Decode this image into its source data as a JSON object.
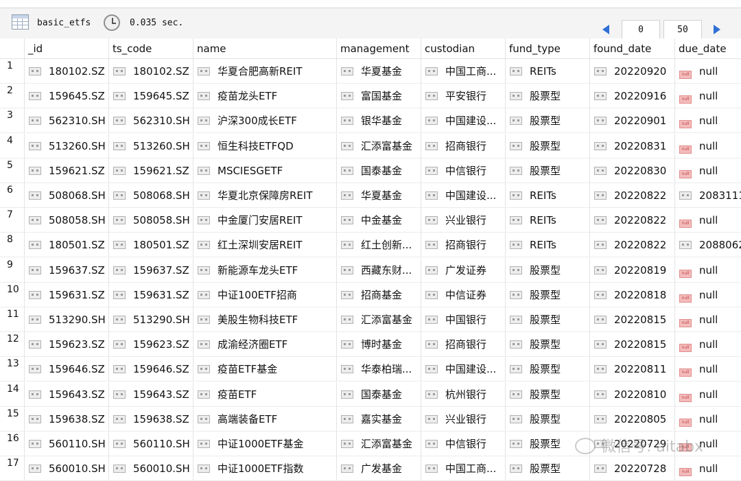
{
  "toolbar": {
    "table_name": "basic_etfs",
    "query_time": "0.035 sec.",
    "pagination": {
      "offset": "0",
      "limit": "50"
    }
  },
  "columns": [
    "_id",
    "ts_code",
    "name",
    "management",
    "custodian",
    "fund_type",
    "found_date",
    "due_date"
  ],
  "rows": [
    {
      "n": "1",
      "id": "180102.SZ",
      "ts": "180102.SZ",
      "name": "华夏合肥高新REIT",
      "mg": "华夏基金",
      "cu": "中国工商...",
      "ft": "REITs",
      "fd": "20220920",
      "dd": "null"
    },
    {
      "n": "2",
      "id": "159645.SZ",
      "ts": "159645.SZ",
      "name": "疫苗龙头ETF",
      "mg": "富国基金",
      "cu": "平安银行",
      "ft": "股票型",
      "fd": "20220916",
      "dd": "null"
    },
    {
      "n": "3",
      "id": "562310.SH",
      "ts": "562310.SH",
      "name": "沪深300成长ETF",
      "mg": "银华基金",
      "cu": "中国建设...",
      "ft": "股票型",
      "fd": "20220901",
      "dd": "null"
    },
    {
      "n": "4",
      "id": "513260.SH",
      "ts": "513260.SH",
      "name": "恒生科技ETFQD",
      "mg": "汇添富基金",
      "cu": "招商银行",
      "ft": "股票型",
      "fd": "20220831",
      "dd": "null"
    },
    {
      "n": "5",
      "id": "159621.SZ",
      "ts": "159621.SZ",
      "name": "MSCIESGETF",
      "mg": "国泰基金",
      "cu": "中信银行",
      "ft": "股票型",
      "fd": "20220830",
      "dd": "null"
    },
    {
      "n": "6",
      "id": "508068.SH",
      "ts": "508068.SH",
      "name": "华夏北京保障房REIT",
      "mg": "华夏基金",
      "cu": "中国建设...",
      "ft": "REITs",
      "fd": "20220822",
      "dd": "2083111"
    },
    {
      "n": "7",
      "id": "508058.SH",
      "ts": "508058.SH",
      "name": "中金厦门安居REIT",
      "mg": "中金基金",
      "cu": "兴业银行",
      "ft": "REITs",
      "fd": "20220822",
      "dd": "null"
    },
    {
      "n": "8",
      "id": "180501.SZ",
      "ts": "180501.SZ",
      "name": "红土深圳安居REIT",
      "mg": "红土创新...",
      "cu": "招商银行",
      "ft": "REITs",
      "fd": "20220822",
      "dd": "2088062"
    },
    {
      "n": "9",
      "id": "159637.SZ",
      "ts": "159637.SZ",
      "name": "新能源车龙头ETF",
      "mg": "西藏东财...",
      "cu": "广发证券",
      "ft": "股票型",
      "fd": "20220819",
      "dd": "null"
    },
    {
      "n": "10",
      "id": "159631.SZ",
      "ts": "159631.SZ",
      "name": "中证100ETF招商",
      "mg": "招商基金",
      "cu": "中信证券",
      "ft": "股票型",
      "fd": "20220818",
      "dd": "null"
    },
    {
      "n": "11",
      "id": "513290.SH",
      "ts": "513290.SH",
      "name": "美股生物科技ETF",
      "mg": "汇添富基金",
      "cu": "中国银行",
      "ft": "股票型",
      "fd": "20220815",
      "dd": "null"
    },
    {
      "n": "12",
      "id": "159623.SZ",
      "ts": "159623.SZ",
      "name": "成渝经济圈ETF",
      "mg": "博时基金",
      "cu": "招商银行",
      "ft": "股票型",
      "fd": "20220815",
      "dd": "null"
    },
    {
      "n": "13",
      "id": "159646.SZ",
      "ts": "159646.SZ",
      "name": "疫苗ETF基金",
      "mg": "华泰柏瑞...",
      "cu": "中国建设...",
      "ft": "股票型",
      "fd": "20220811",
      "dd": "null"
    },
    {
      "n": "14",
      "id": "159643.SZ",
      "ts": "159643.SZ",
      "name": "疫苗ETF",
      "mg": "国泰基金",
      "cu": "杭州银行",
      "ft": "股票型",
      "fd": "20220810",
      "dd": "null"
    },
    {
      "n": "15",
      "id": "159638.SZ",
      "ts": "159638.SZ",
      "name": "高端装备ETF",
      "mg": "嘉实基金",
      "cu": "兴业银行",
      "ft": "股票型",
      "fd": "20220805",
      "dd": "null"
    },
    {
      "n": "16",
      "id": "560110.SH",
      "ts": "560110.SH",
      "name": "中证1000ETF基金",
      "mg": "汇添富基金",
      "cu": "中信银行",
      "ft": "股票型",
      "fd": "20220729",
      "dd": "null"
    },
    {
      "n": "17",
      "id": "560010.SH",
      "ts": "560010.SH",
      "name": "中证1000ETF指数",
      "mg": "广发基金",
      "cu": "中国工商...",
      "ft": "股票型",
      "fd": "20220728",
      "dd": "null"
    }
  ],
  "watermark": "微信号: aitabx"
}
